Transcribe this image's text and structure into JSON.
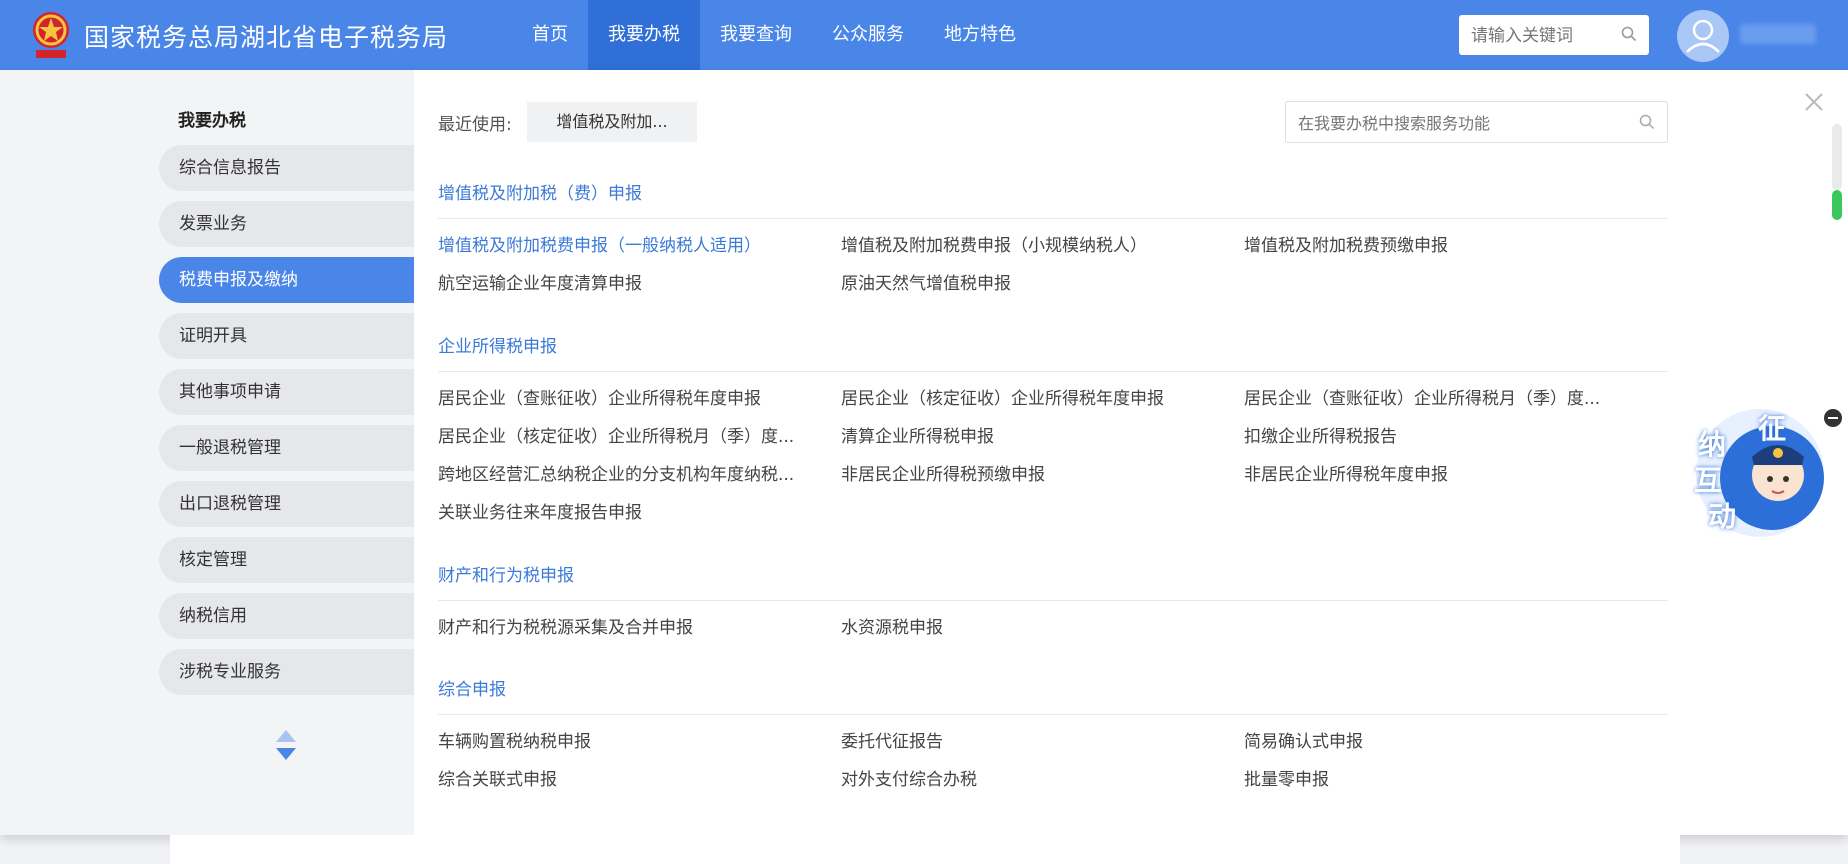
{
  "header": {
    "site_title": "国家税务总局湖北省电子税务局",
    "nav": [
      "首页",
      "我要办税",
      "我要查询",
      "公众服务",
      "地方特色"
    ],
    "active_nav": "我要办税",
    "search_placeholder": "请输入关键词",
    "brand_color": "#4a86e8"
  },
  "sidebar": {
    "title": "我要办税",
    "items": [
      "综合信息报告",
      "发票业务",
      "税费申报及缴纳",
      "证明开具",
      "其他事项申请",
      "一般退税管理",
      "出口退税管理",
      "核定管理",
      "纳税信用",
      "涉税专业服务"
    ],
    "active_item": "税费申报及缴纳"
  },
  "main": {
    "recent_label": "最近使用:",
    "recent_item": "增值税及附加...",
    "search_placeholder": "在我要办税中搜索服务功能",
    "sections": [
      {
        "title": "增值税及附加税（费）申报",
        "items": [
          "增值税及附加税费申报（一般纳税人适用）",
          "增值税及附加税费申报（小规模纳税人）",
          "增值税及附加税费预缴申报",
          "航空运输企业年度清算申报",
          "原油天然气增值税申报"
        ]
      },
      {
        "title": "企业所得税申报",
        "items": [
          "居民企业（查账征收）企业所得税年度申报",
          "居民企业（核定征收）企业所得税年度申报",
          "居民企业（查账征收）企业所得税月（季）度...",
          "居民企业（核定征收）企业所得税月（季）度...",
          "清算企业所得税申报",
          "扣缴企业所得税报告",
          "跨地区经营汇总纳税企业的分支机构年度纳税...",
          "非居民企业所得税预缴申报",
          "非居民企业所得税年度申报",
          "关联业务往来年度报告申报"
        ]
      },
      {
        "title": "财产和行为税申报",
        "items": [
          "财产和行为税税源采集及合并申报",
          "水资源税申报"
        ]
      },
      {
        "title": "综合申报",
        "items": [
          "车辆购置税纳税申报",
          "委托代征报告",
          "简易确认式申报",
          "综合关联式申报",
          "对外支付综合办税",
          "批量零申报"
        ]
      }
    ]
  },
  "float_widget": {
    "chars": [
      "征",
      "纳",
      "互",
      "动"
    ]
  }
}
